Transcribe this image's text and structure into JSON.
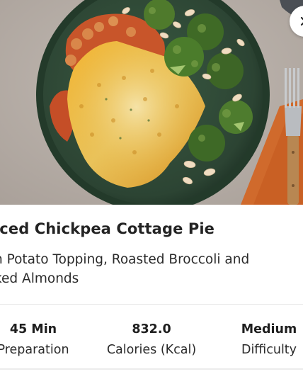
{
  "recipe": {
    "title": "iced Chickpea Cottage Pie",
    "subtitle": "h Potato Topping, Roasted Broccoli and ked Almonds"
  },
  "stats": [
    {
      "value": "45 Min",
      "label": "Preparation"
    },
    {
      "value": "832.0",
      "label": "Calories (Kcal)"
    },
    {
      "value": "Medium",
      "label": "Difficulty"
    }
  ],
  "icons": {
    "close": "close-icon",
    "hero": "recipe-photo"
  },
  "colors": {
    "plate": "#2f4a36",
    "background": "#b9b1aa",
    "napkin": "#d06a2c"
  }
}
